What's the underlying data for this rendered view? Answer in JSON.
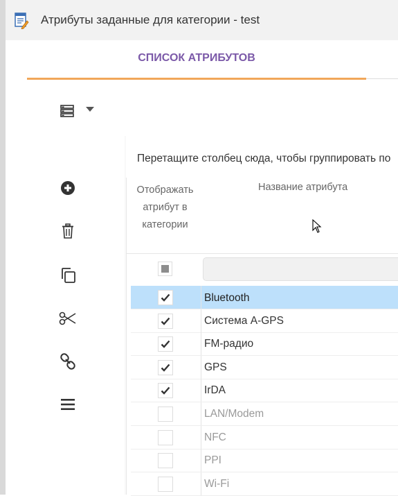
{
  "window": {
    "title": "Атрибуты заданные для категории - test",
    "icon": "document-edit-icon"
  },
  "tabs": [
    {
      "label": "СПИСОК АТРИБУТОВ",
      "active": true
    }
  ],
  "colors": {
    "tab_text": "#7b59a8",
    "tab_underline": "#f1a75a",
    "selected_row": "#bde0fb"
  },
  "toolbar": {
    "items": [
      {
        "icon": "list-menu-icon",
        "has_dropdown": true
      },
      {
        "icon": "add-circle-icon"
      },
      {
        "icon": "trash-icon"
      },
      {
        "icon": "copy-icon"
      },
      {
        "icon": "scissors-icon"
      },
      {
        "icon": "link-icon"
      },
      {
        "icon": "hamburger-icon"
      }
    ]
  },
  "grid": {
    "group_panel_text": "Перетащите столбец сюда, чтобы группировать по",
    "columns": [
      {
        "label": "Отображать атрибут в категории"
      },
      {
        "label": "Название атрибута"
      }
    ],
    "rows": [
      {
        "name": "Bluetooth",
        "checked": true,
        "selected": true
      },
      {
        "name": "Система A-GPS",
        "checked": true,
        "selected": false
      },
      {
        "name": "FM-радио",
        "checked": true,
        "selected": false
      },
      {
        "name": "GPS",
        "checked": true,
        "selected": false
      },
      {
        "name": "IrDA",
        "checked": true,
        "selected": false
      },
      {
        "name": "LAN/Modem",
        "checked": false,
        "selected": false
      },
      {
        "name": "NFC",
        "checked": false,
        "selected": false
      },
      {
        "name": "PPI",
        "checked": false,
        "selected": false
      },
      {
        "name": "Wi-Fi",
        "checked": false,
        "selected": false
      }
    ]
  }
}
